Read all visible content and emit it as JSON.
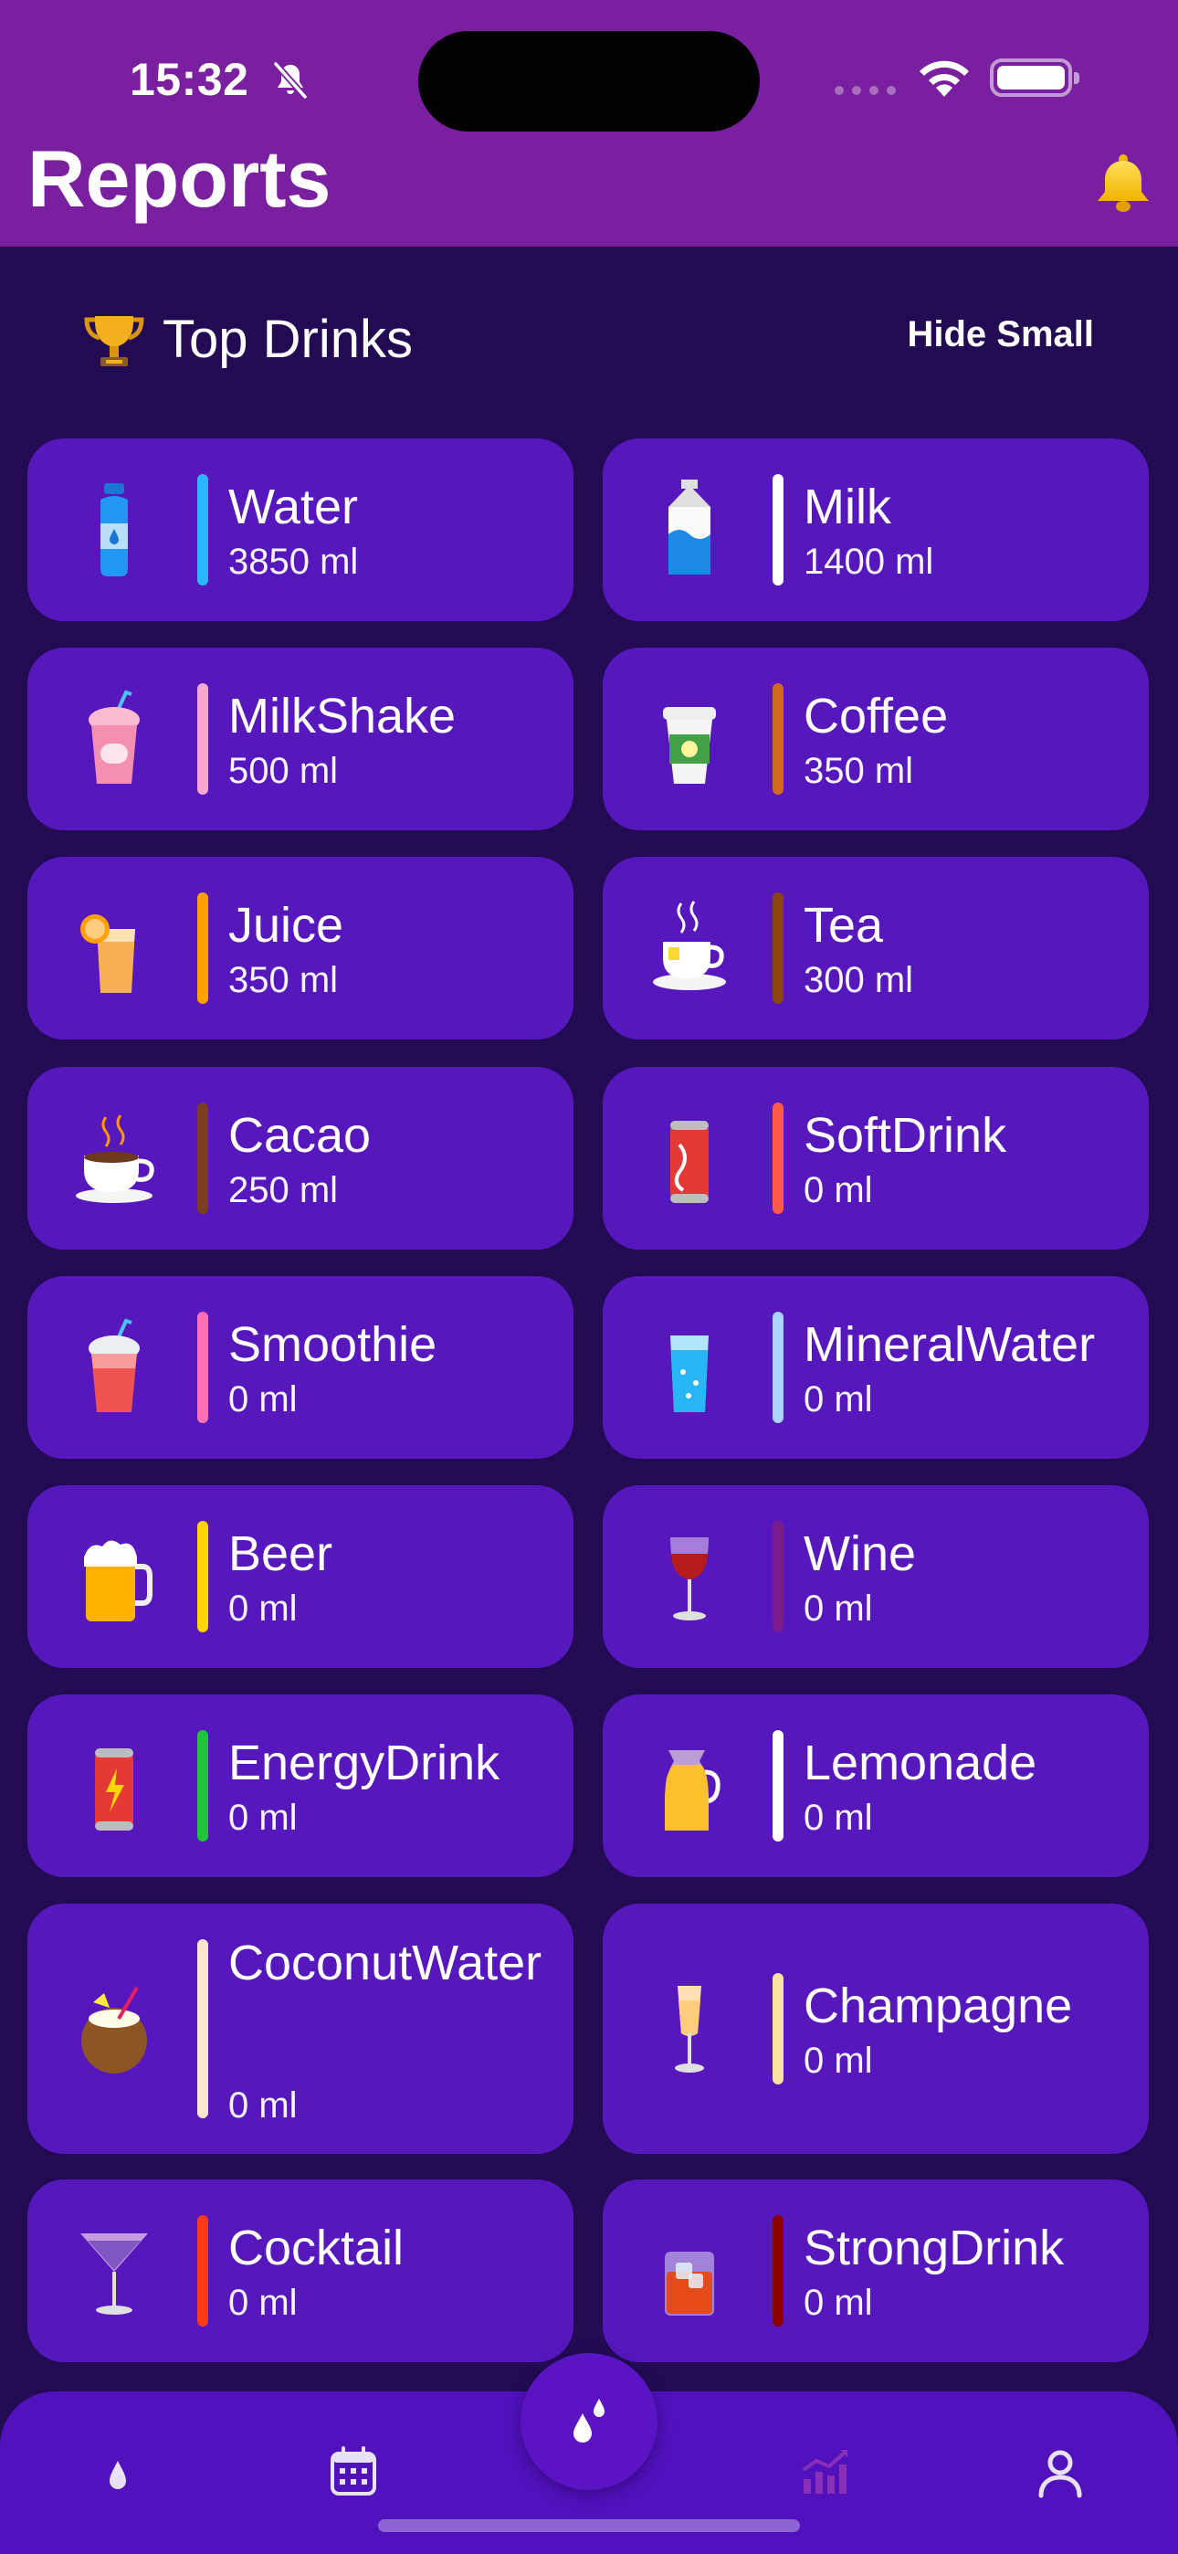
{
  "status_bar": {
    "time": "15:32"
  },
  "header": {
    "title": "Reports"
  },
  "section": {
    "title": "Top Drinks",
    "toggle_label": "Hide Small"
  },
  "drinks": [
    {
      "name": "Water",
      "amount": "3850 ml",
      "bar_color": "#2cb6ff",
      "icon": "water-bottle-icon"
    },
    {
      "name": "Milk",
      "amount": "1400 ml",
      "bar_color": "#ffffff",
      "icon": "milk-carton-icon"
    },
    {
      "name": "MilkShake",
      "amount": "500 ml",
      "bar_color": "#f7a7d2",
      "icon": "milkshake-cup-icon"
    },
    {
      "name": "Coffee",
      "amount": "350 ml",
      "bar_color": "#d2691e",
      "icon": "coffee-cup-icon"
    },
    {
      "name": "Juice",
      "amount": "350 ml",
      "bar_color": "#ffa000",
      "icon": "juice-glass-icon"
    },
    {
      "name": "Tea",
      "amount": "300 ml",
      "bar_color": "#8b4513",
      "icon": "tea-cup-icon"
    },
    {
      "name": "Cacao",
      "amount": "250 ml",
      "bar_color": "#7b3f1f",
      "icon": "cacao-cup-icon"
    },
    {
      "name": "SoftDrink",
      "amount": "0 ml",
      "bar_color": "#ff5a4a",
      "icon": "soda-can-icon"
    },
    {
      "name": "Smoothie",
      "amount": "0 ml",
      "bar_color": "#ff6fb5",
      "icon": "smoothie-cup-icon"
    },
    {
      "name": "MineralWater",
      "amount": "0 ml",
      "bar_color": "#a9d4ff",
      "icon": "mineral-water-glass-icon"
    },
    {
      "name": "Beer",
      "amount": "0 ml",
      "bar_color": "#ffd400",
      "icon": "beer-mug-icon"
    },
    {
      "name": "Wine",
      "amount": "0 ml",
      "bar_color": "#7b1c8c",
      "icon": "wine-glass-icon"
    },
    {
      "name": "EnergyDrink",
      "amount": "0 ml",
      "bar_color": "#22c43a",
      "icon": "energy-drink-can-icon"
    },
    {
      "name": "Lemonade",
      "amount": "0 ml",
      "bar_color": "#ffffff",
      "icon": "lemonade-jug-icon"
    },
    {
      "name": "CoconutWater",
      "amount": "0 ml",
      "bar_color": "#fbe7cf",
      "icon": "coconut-icon"
    },
    {
      "name": "Champagne",
      "amount": "0 ml",
      "bar_color": "#f7e2a1",
      "icon": "champagne-flute-icon"
    },
    {
      "name": "Cocktail",
      "amount": "0 ml",
      "bar_color": "#ff3a14",
      "icon": "cocktail-glass-icon"
    },
    {
      "name": "StrongDrink",
      "amount": "0 ml",
      "bar_color": "#8b0000",
      "icon": "whiskey-glass-icon"
    }
  ],
  "tabbar": {
    "tabs": [
      {
        "name": "tab-today",
        "icon": "water-drop-icon"
      },
      {
        "name": "tab-calendar",
        "icon": "calendar-icon"
      },
      {
        "name": "tab-add",
        "icon": "two-drops-icon"
      },
      {
        "name": "tab-reports",
        "icon": "bar-chart-icon",
        "active": true
      },
      {
        "name": "tab-profile",
        "icon": "person-icon"
      }
    ],
    "active_color": "#8a2fb8"
  }
}
